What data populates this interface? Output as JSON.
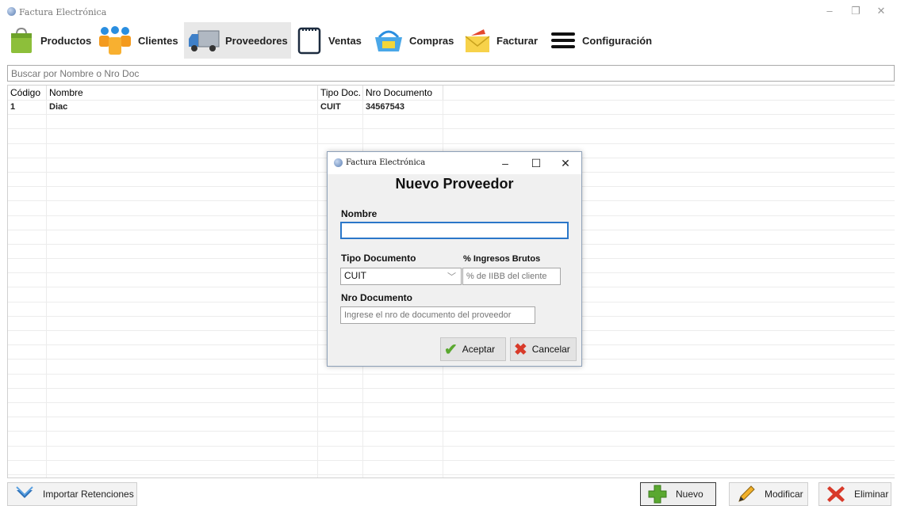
{
  "window": {
    "title": "Factura Electrónica",
    "minimize": "–",
    "restore": "❐",
    "close": "✕"
  },
  "toolbar": {
    "items": [
      {
        "label": "Productos",
        "icon": "shopping-bag-icon"
      },
      {
        "label": "Clientes",
        "icon": "people-icon"
      },
      {
        "label": "Proveedores",
        "icon": "truck-icon",
        "active": true
      },
      {
        "label": "Ventas",
        "icon": "notepad-icon"
      },
      {
        "label": "Compras",
        "icon": "basket-icon"
      },
      {
        "label": "Facturar",
        "icon": "envelope-icon"
      },
      {
        "label": "Configuración",
        "icon": "hamburger-menu-icon"
      }
    ]
  },
  "search": {
    "placeholder": "Buscar por Nombre o Nro Doc"
  },
  "grid": {
    "columns": [
      "Código",
      "Nombre",
      "Tipo Doc.",
      "Nro Documento"
    ],
    "rows": [
      {
        "codigo": "1",
        "nombre": "Diac",
        "tipo_doc": "CUIT",
        "nro_documento": "34567543"
      }
    ]
  },
  "bottom": {
    "importar": "Importar Retenciones",
    "nuevo": "Nuevo",
    "modificar": "Modificar",
    "eliminar": "Eliminar"
  },
  "dialog": {
    "title": "Factura Electrónica",
    "minimize": "–",
    "maximize": "☐",
    "close": "✕",
    "heading": "Nuevo Proveedor",
    "nombre_label": "Nombre",
    "nombre_value": "",
    "tipo_doc_label": "Tipo Documento",
    "tipo_doc_value": "CUIT",
    "iibb_label": "% Ingresos Brutos",
    "iibb_placeholder": "% de IIBB del cliente",
    "nro_doc_label": "Nro Documento",
    "nro_doc_placeholder": "Ingrese el nro de documento del proveedor",
    "aceptar": "Aceptar",
    "cancelar": "Cancelar"
  },
  "colors": {
    "focus_border": "#2b77c9",
    "accept_green": "#5aa830",
    "cancel_red": "#d83a2a"
  }
}
